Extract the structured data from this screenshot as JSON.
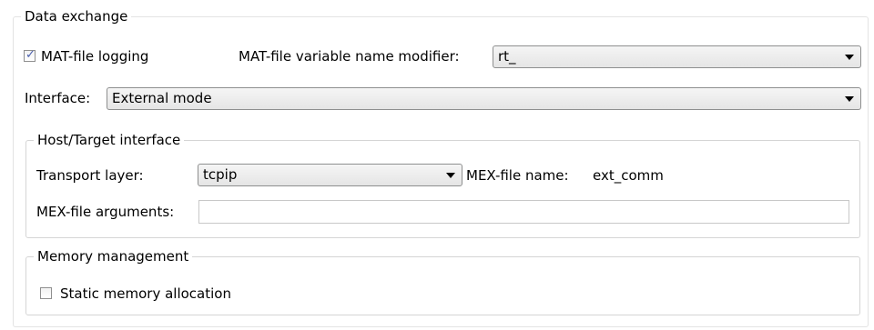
{
  "data_exchange": {
    "title": "Data exchange",
    "mat_logging": {
      "label": "MAT-file logging",
      "checked": true
    },
    "mat_modifier": {
      "label": "MAT-file variable name modifier:",
      "value": "rt_"
    },
    "interface": {
      "label": "Interface:",
      "value": "External mode"
    }
  },
  "host_target": {
    "title": "Host/Target interface",
    "transport": {
      "label": "Transport layer:",
      "value": "tcpip"
    },
    "mex_name": {
      "label": "MEX-file name:",
      "value": "ext_comm"
    },
    "mex_args": {
      "label": "MEX-file arguments:",
      "value": ""
    }
  },
  "memory": {
    "title": "Memory management",
    "static_alloc": {
      "label": "Static memory allocation",
      "checked": false
    }
  },
  "colors": {
    "border": "#d5d5d5",
    "check_mark": "#4a5fae"
  },
  "icons": {
    "dropdown": "chevron-down-icon",
    "check": "checkmark-icon"
  }
}
